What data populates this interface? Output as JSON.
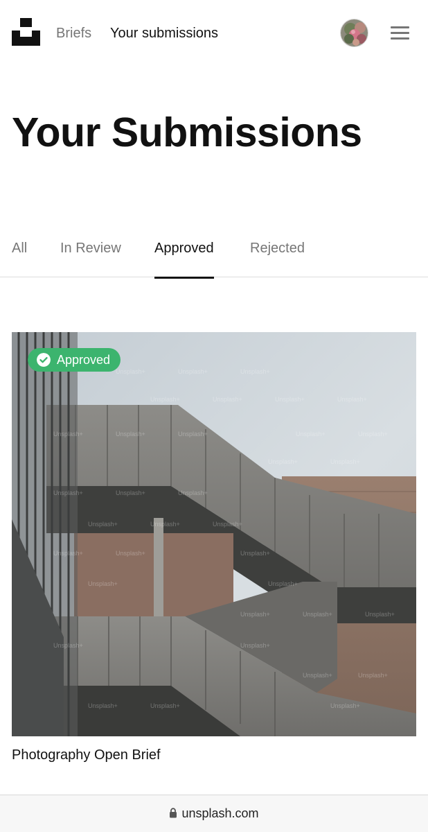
{
  "nav": {
    "briefs": "Briefs",
    "submissions": "Your submissions"
  },
  "page": {
    "title": "Your Submissions"
  },
  "tabs": [
    {
      "label": "All"
    },
    {
      "label": "In Review"
    },
    {
      "label": "Approved",
      "active": true
    },
    {
      "label": "Rejected"
    }
  ],
  "submission": {
    "status": "Approved",
    "status_color": "#3cb46e",
    "title": "Photography Open Brief",
    "watermark": "Unsplash+"
  },
  "browser": {
    "url": "unsplash.com"
  },
  "icons": {
    "logo": "unsplash-logo",
    "menu": "hamburger-menu-icon",
    "lock": "lock-icon",
    "check": "check-circle-icon"
  }
}
